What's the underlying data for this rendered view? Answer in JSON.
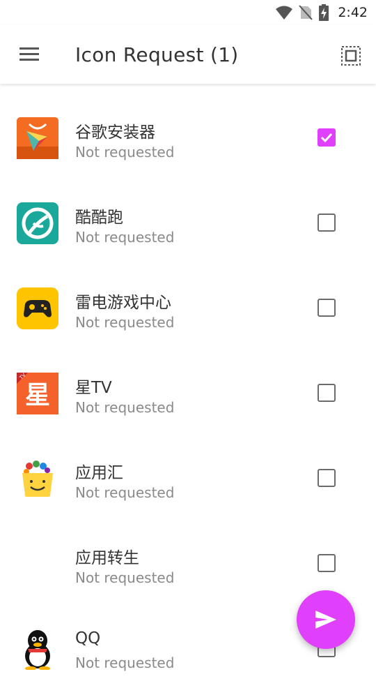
{
  "status_bar": {
    "time": "2:42",
    "icons": [
      "wifi-icon",
      "no-sim-icon",
      "battery-charging-icon"
    ]
  },
  "app_bar": {
    "title": "Icon Request (1)",
    "left_icon": "menu-icon",
    "right_icon": "select-all-icon"
  },
  "apps": [
    {
      "name": "谷歌安装器",
      "status": "Not requested",
      "checked": true,
      "icon": "google-installer-icon"
    },
    {
      "name": "酷酷跑",
      "status": "Not requested",
      "checked": false,
      "icon": "kukupao-icon"
    },
    {
      "name": "雷电游戏中心",
      "status": "Not requested",
      "checked": false,
      "icon": "gamepad-icon"
    },
    {
      "name": "星TV",
      "status": "Not requested",
      "checked": false,
      "icon": "xing-tv-icon",
      "icon_text": "星",
      "badge_text": "TV"
    },
    {
      "name": "应用汇",
      "status": "Not requested",
      "checked": false,
      "icon": "shopping-bag-icon"
    },
    {
      "name": "应用转生",
      "status": "Not requested",
      "checked": false,
      "icon": ""
    },
    {
      "name": "QQ",
      "status": "Not requested",
      "checked": false,
      "icon": "qq-penguin-icon"
    }
  ],
  "fab": {
    "icon": "send-icon"
  },
  "colors": {
    "accent": "#e040fb",
    "text_primary": "#333333",
    "text_secondary": "#8a8a8a"
  }
}
